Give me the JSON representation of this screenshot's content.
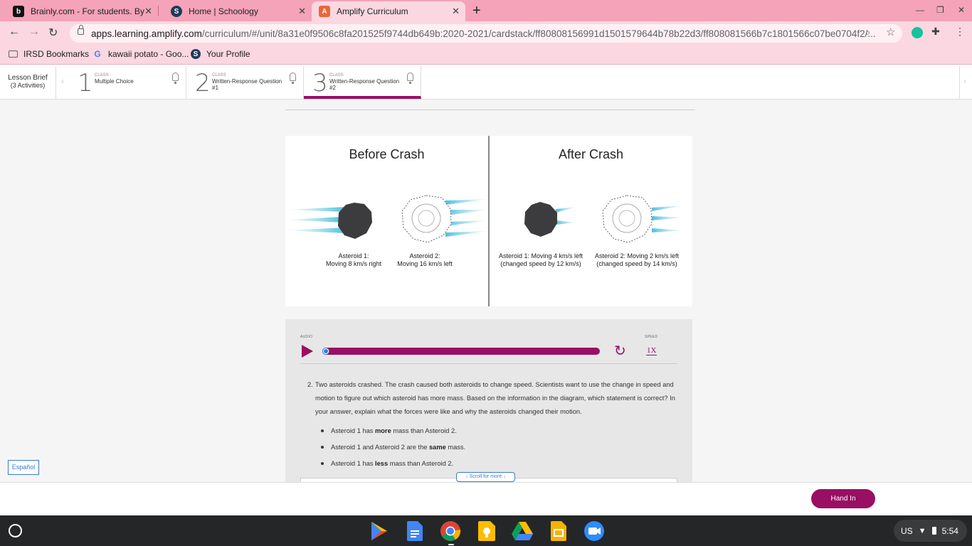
{
  "browser": {
    "tabs": [
      {
        "title": "Brainly.com - For students. By st",
        "favicon": "brainly-icon",
        "color": "#111111"
      },
      {
        "title": "Home | Schoology",
        "favicon": "schoology-icon",
        "color": "#1f3a5a"
      },
      {
        "title": "Amplify Curriculum",
        "favicon": "amplify-icon",
        "color": "#e8683a"
      }
    ],
    "url_host": "apps.learning.amplify.com",
    "url_path": "/curriculum/#/unit/8a31e0f9506c8fa201525f9744db649b:2020-2021/cardstack/ff80808156991d1501579644b78b22d3/ff808081566b7c1801566c07be0704f2/...",
    "bookmarks": [
      {
        "label": "IRSD Bookmarks",
        "icon": "folder-icon"
      },
      {
        "label": "kawaii potato - Goo...",
        "icon": "google-icon"
      },
      {
        "label": "Your Profile",
        "icon": "schoology-icon"
      }
    ]
  },
  "header": {
    "lesson_brief": "Lesson Brief",
    "activities_count": "(3 Activities)",
    "activities": [
      {
        "number": "1",
        "class_label": "CLASS",
        "title": "Multiple Choice"
      },
      {
        "number": "2",
        "class_label": "CLASS",
        "title": "Written-Response Question #1"
      },
      {
        "number": "3",
        "class_label": "CLASS",
        "title": "Written-Response Question #2"
      }
    ]
  },
  "diagram": {
    "before_title": "Before Crash",
    "after_title": "After Crash",
    "before_ast1_name": "Asteroid 1:",
    "before_ast1_motion": "Moving 8 km/s right",
    "before_ast2_name": "Asteroid 2:",
    "before_ast2_motion": "Moving 16 km/s left",
    "after_ast1_line1": "Asteroid 1: Moving 4 km/s left",
    "after_ast1_line2": "(changed speed by 12 km/s)",
    "after_ast2_line1": "Asteroid 2: Moving 2 km/s left",
    "after_ast2_line2": "(changed speed by 14 km/s)"
  },
  "audio": {
    "label": "AUDIO",
    "speed_label": "SPEED",
    "speed_value": "1X",
    "progress_fraction": 0.01
  },
  "question": {
    "number": "2.",
    "text": "Two asteroids crashed. The crash caused both asteroids to change speed. Scientists want to use the change in speed and motion to figure out which asteroid has more mass. Based on the information in the diagram, which statement is correct? In your answer, explain what the forces were like and why the asteroids changed their motion.",
    "options": [
      {
        "before": "Asteroid 1 has ",
        "bold": "more",
        "after": " mass than Asteroid 2."
      },
      {
        "before": "Asteroid 1 and Asteroid 2 are the ",
        "bold": "same",
        "after": " mass."
      },
      {
        "before": "Asteroid 1 has ",
        "bold": "less",
        "after": " mass than Asteroid 2."
      }
    ]
  },
  "scroll_hint": "Scroll for more",
  "espanol": "Español",
  "hand_in": "Hand In",
  "shelf": {
    "apps": [
      "play-store-icon",
      "docs-icon",
      "chrome-icon",
      "keep-icon",
      "drive-icon",
      "slides-icon",
      "meet-icon"
    ],
    "locale": "US",
    "time": "5:54"
  },
  "colors": {
    "accent": "#990f63",
    "link": "#3a7bd5",
    "tab_strip": "#f4a3b8"
  }
}
